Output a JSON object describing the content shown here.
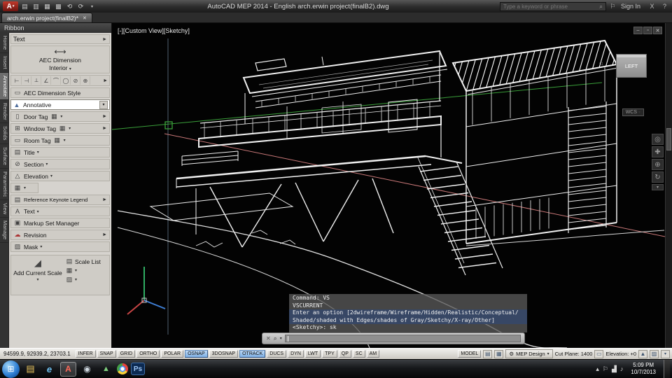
{
  "icons": {
    "dropdown": "▾",
    "flyout": "►",
    "close": "✕",
    "help": "?",
    "search": "⌕",
    "minimize": "–",
    "restore": "▫",
    "home": "⌂",
    "gear": "⚙",
    "flag": "⚐",
    "new": "▤",
    "open": "▥",
    "save": "▦",
    "plot": "▩",
    "undo": "⟲",
    "redo": "⟳",
    "aec_dimension": "⟷",
    "dim_style": "▭",
    "annotative": "▲",
    "door": "▯",
    "window": "⊞",
    "room": "▭",
    "title": "▤",
    "section": "⊘",
    "elevation": "△",
    "keynote": "▤",
    "text": "A",
    "markup": "▣",
    "revision": "☁",
    "mask": "▨",
    "scale": "◢",
    "scale_list": "▤",
    "grid": "▦",
    "nav_wheel": "◎",
    "nav_pan": "✚",
    "nav_zoom": "⊕",
    "nav_orbit": "↻",
    "cmd_close": "✕",
    "cmd_search": "⌕"
  },
  "titlebar": {
    "logo_letter": "A",
    "title": "AutoCAD MEP 2014 - English    arch.erwin project(finalB2).dwg",
    "search_placeholder": "Type a keyword or phrase",
    "sign_in_label": "Sign In",
    "exchange_label": "X"
  },
  "tabbar": {
    "active_tab": "arch.erwin project(finalB2)*"
  },
  "palette": {
    "caption": "Ribbon",
    "vertical_tabs": [
      {
        "label": "Home",
        "active": false
      },
      {
        "label": "Insert",
        "active": false
      },
      {
        "label": "Annotate",
        "active": true
      },
      {
        "label": "Render",
        "active": false
      },
      {
        "label": "Solids",
        "active": false
      },
      {
        "label": "Surface",
        "active": false
      },
      {
        "label": "Parametric",
        "active": false
      },
      {
        "label": "View",
        "active": false
      },
      {
        "label": "Manage",
        "active": false
      }
    ],
    "rows": {
      "text_flyout": "Text",
      "aec_dim_line1": "AEC Dimension",
      "aec_dim_line2": "Interior",
      "tool_icons": [
        "⊢",
        "⊣",
        "⟂",
        "∠",
        "⌒",
        "◯",
        "⊘",
        "⊕"
      ],
      "aec_dim_style": "AEC Dimension Style",
      "annotative": "Annotative",
      "door_tag": "Door Tag",
      "window_tag": "Window Tag",
      "room_tag": "Room Tag",
      "title": "Title",
      "section": "Section",
      "elevation": "Elevation",
      "reference_keynote": "Reference Keynote Legend",
      "text": "Text",
      "markup": "Markup Set Manager",
      "revision": "Revision",
      "mask": "Mask",
      "add_current_scale": "Add Current Scale",
      "scale_list": "Scale List"
    }
  },
  "viewport": {
    "view_label": "[-][Custom View][Sketchy]",
    "viewcube_face": "LEFT",
    "wcs_label": "WCS",
    "command_history": [
      {
        "text": "Command: VS",
        "active": false
      },
      {
        "text": "VSCURRENT",
        "active": false
      },
      {
        "text": "Enter an option [2dwireframe/Wireframe/Hidden/Realistic/Conceptual/",
        "active": true
      },
      {
        "text": "Shaded/shaded with Edges/shades of Gray/Sketchy/X-ray/Other]",
        "active": true
      },
      {
        "text": "<Sketchy>: sk",
        "active": false
      }
    ]
  },
  "statusbar": {
    "coordinates": "94599.9, 92939.2, 23703.1",
    "toggles": [
      {
        "label": "INFER",
        "active": false
      },
      {
        "label": "SNAP",
        "active": false
      },
      {
        "label": "GRID",
        "active": false
      },
      {
        "label": "ORTHO",
        "active": false
      },
      {
        "label": "POLAR",
        "active": false
      },
      {
        "label": "OSNAP",
        "active": true
      },
      {
        "label": "3DOSNAP",
        "active": false
      },
      {
        "label": "OTRACK",
        "active": true
      },
      {
        "label": "DUCS",
        "active": false
      },
      {
        "label": "DYN",
        "active": false
      },
      {
        "label": "LWT",
        "active": false
      },
      {
        "label": "TPY",
        "active": false
      },
      {
        "label": "QP",
        "active": false
      },
      {
        "label": "SC",
        "active": false
      },
      {
        "label": "AM",
        "active": false
      }
    ],
    "model_label": "MODEL",
    "workspace": "MEP Design",
    "cut_plane": "Cut Plane: 1400",
    "elevation": "Elevation: +0"
  },
  "taskbar": {
    "icons": [
      {
        "name": "start-button",
        "glyph": "⊞",
        "style": "width:25px;height:25px;border-radius:50%;background:radial-gradient(circle at 35% 30%,#9fd4f7,#2f7fd4 55%,#0a3d7e);color:#fff;font-size:12px;"
      },
      {
        "name": "explorer-icon",
        "glyph": "▤",
        "style": "color:#eac55e;"
      },
      {
        "name": "browser-icon",
        "glyph": "e",
        "style": "color:#6fc1f0;font-style:italic;font-weight:bold;"
      },
      {
        "name": "autocad-icon",
        "glyph": "A",
        "style": "color:#ff6a5a;font-weight:bold;font-size:12px;background:rgba(255,255,255,.16);border:1px solid rgba(255,255,255,.4);"
      },
      {
        "name": "media-player-icon",
        "glyph": "◉",
        "style": "color:#cfd8e0;font-size:12px;"
      },
      {
        "name": "sketchup-icon",
        "glyph": "▲",
        "style": "color:#7fd07f;font-size:11px;"
      },
      {
        "name": "chrome-icon",
        "glyph": "",
        "style": "width:16px;height:16px;border-radius:50%;background:radial-gradient(circle at 50% 50%,#fff 0 24%,#4a8df0 25% 38%,rgba(0,0,0,0) 39%),conic-gradient(#e8453c 0 120deg,#f7d038 120deg 240deg,#43a047 240deg 360deg);"
      },
      {
        "name": "photoshop-icon",
        "glyph": "Ps",
        "style": "color:#9fc6f5;background:#0c2a52;border:1px solid #3f6ea8;font-size:10px;font-weight:bold;width:20px;height:18px;"
      }
    ],
    "tray_icons": [
      {
        "name": "show-hidden-icons",
        "glyph": "▴"
      },
      {
        "name": "action-center-icon",
        "glyph": "⚐"
      },
      {
        "name": "network-icon",
        "glyph": "▟"
      },
      {
        "name": "volume-icon",
        "glyph": "♪"
      }
    ],
    "clock": {
      "time": "5:09 PM",
      "date": "10/7/2013"
    }
  }
}
